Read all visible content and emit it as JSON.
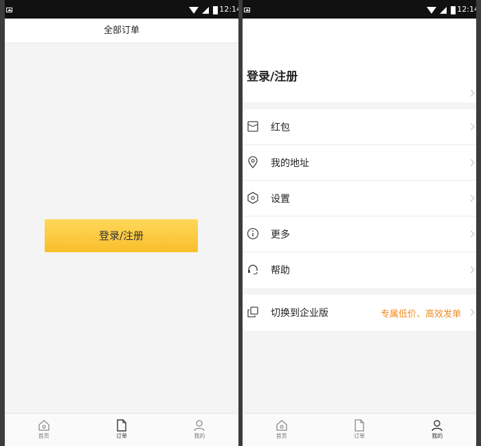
{
  "status_bar": {
    "time": "12:14"
  },
  "left_screen": {
    "title": "全部订单",
    "login_button": "登录/注册"
  },
  "right_screen": {
    "profile_login": "登录/注册",
    "menu": [
      {
        "label": "红包",
        "icon": "red-envelope-icon"
      },
      {
        "label": "我的地址",
        "icon": "location-pin-icon"
      },
      {
        "label": "设置",
        "icon": "settings-hexagon-icon"
      },
      {
        "label": "更多",
        "icon": "info-icon"
      },
      {
        "label": "帮助",
        "icon": "headset-icon"
      }
    ],
    "enterprise": {
      "label": "切换到企业版",
      "promo": "专属低价、高效发单",
      "icon": "switch-icon"
    }
  },
  "tabbar": {
    "tabs": [
      {
        "label": "首页",
        "icon": "home-icon"
      },
      {
        "label": "订单",
        "icon": "order-document-icon"
      },
      {
        "label": "我的",
        "icon": "person-icon"
      }
    ]
  },
  "colors": {
    "accent_yellow": "#f9be2b",
    "promo_orange": "#f08a1c",
    "status_bar": "#111111"
  }
}
